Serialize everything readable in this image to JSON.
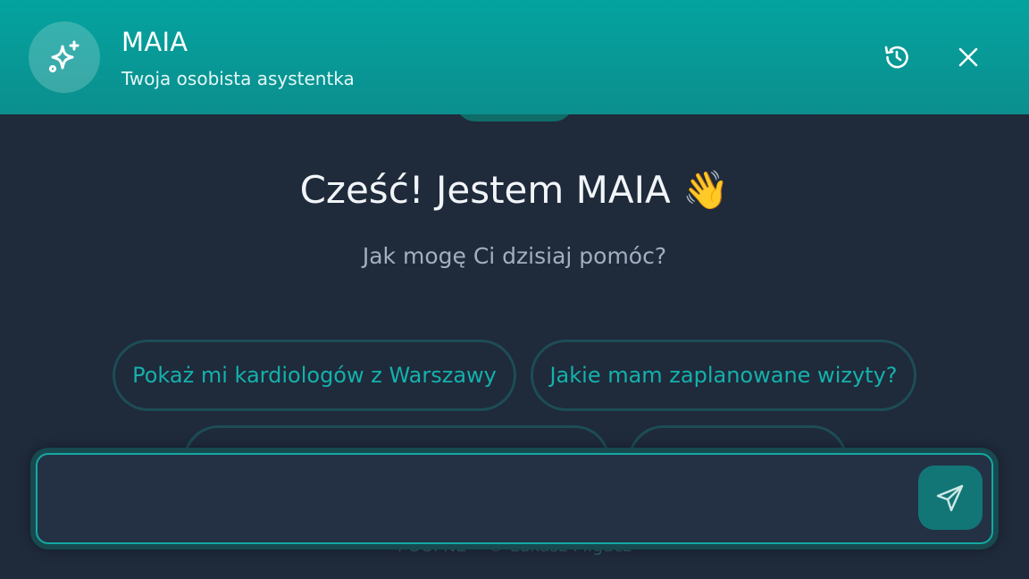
{
  "header": {
    "title": "MAIA",
    "subtitle": "Twoja osobista asystentka",
    "avatar_icon": "sparkles-icon",
    "history_icon": "history-icon",
    "close_icon": "close-icon"
  },
  "hero": {
    "greeting": "Cześć! Jestem MAIA 👋",
    "subtitle": "Jak mogę Ci dzisiaj pomóc?"
  },
  "suggestions": [
    {
      "label": "Pokaż mi kardiologów z Warszawy"
    },
    {
      "label": "Jakie mam zaplanowane wizyty?"
    },
    {
      "label": ""
    },
    {
      "label": ""
    }
  ],
  "input": {
    "value": "",
    "placeholder": "",
    "send_icon": "send-icon"
  },
  "footer": {
    "text": "POUFNE • © Łukasz Migacz"
  },
  "colors": {
    "header_top": "#04a39f",
    "header_bottom": "#0b8f8e",
    "background": "#1f2a3b",
    "accent": "#14b1ab",
    "send_button": "#127677"
  }
}
